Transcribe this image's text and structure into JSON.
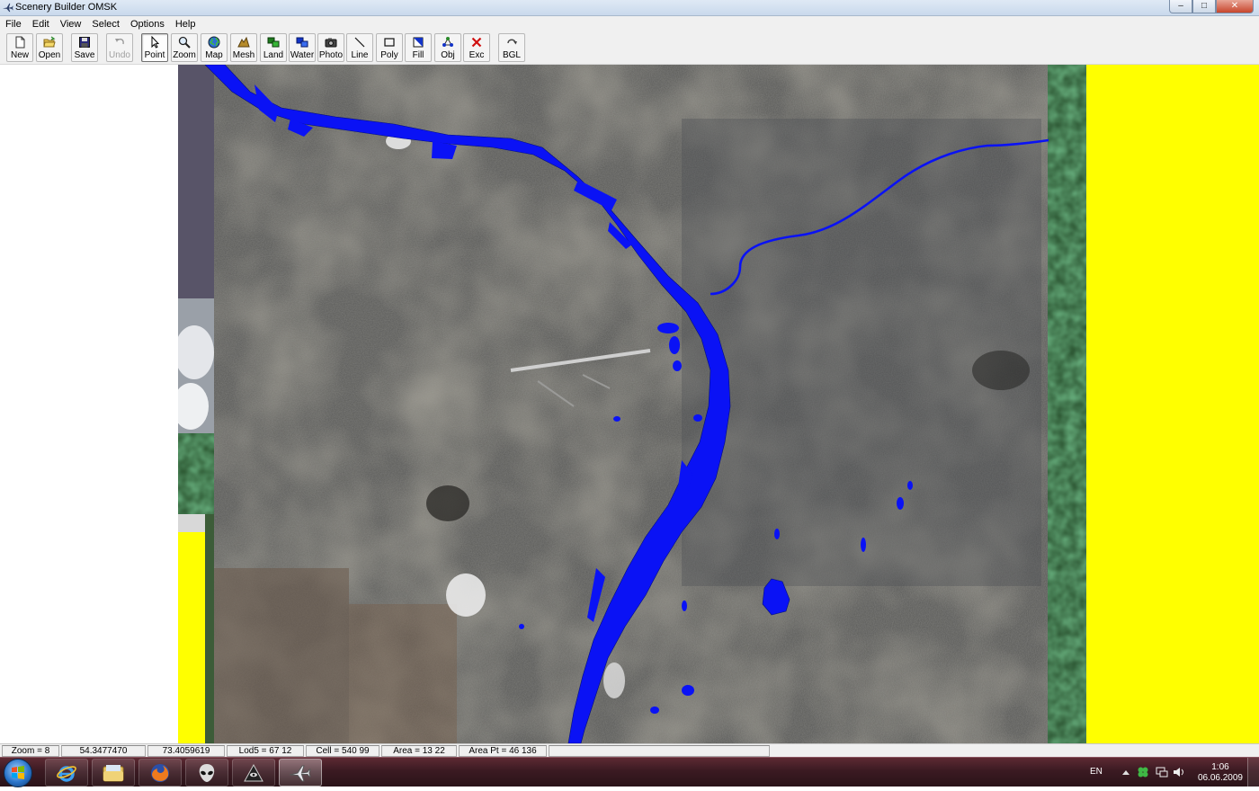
{
  "window": {
    "title": "Scenery Builder  OMSK",
    "controls": {
      "minimize": "–",
      "maximize": "□",
      "close": "✕"
    }
  },
  "menu": [
    "File",
    "Edit",
    "View",
    "Select",
    "Options",
    "Help"
  ],
  "toolbar": [
    {
      "label": "New",
      "icon": "new-file-icon"
    },
    {
      "label": "Open",
      "icon": "open-folder-icon"
    },
    {
      "label": "Save",
      "icon": "save-icon"
    },
    {
      "label": "Undo",
      "icon": "undo-icon",
      "disabled": true
    },
    {
      "label": "Point",
      "icon": "pointer-icon",
      "active": true
    },
    {
      "label": "Zoom",
      "icon": "magnifier-icon"
    },
    {
      "label": "Map",
      "icon": "globe-icon"
    },
    {
      "label": "Mesh",
      "icon": "mesh-icon"
    },
    {
      "label": "Land",
      "icon": "land-icon"
    },
    {
      "label": "Water",
      "icon": "water-icon"
    },
    {
      "label": "Photo",
      "icon": "camera-icon"
    },
    {
      "label": "Line",
      "icon": "line-icon"
    },
    {
      "label": "Poly",
      "icon": "polygon-icon"
    },
    {
      "label": "Fill",
      "icon": "fill-icon"
    },
    {
      "label": "Obj",
      "icon": "object-icon"
    },
    {
      "label": "Exc",
      "icon": "exclude-icon"
    },
    {
      "label": "BGL",
      "icon": "bgl-compile-icon"
    }
  ],
  "colors": {
    "water": "#0a12f5",
    "background_fill": "#ffff00",
    "satellite_base": "#5a5a58"
  },
  "status": [
    "Zoom = 8",
    "54.3477470",
    "73.4059619",
    "Lod5 = 67 12",
    "Cell = 540 99",
    "Area = 13 22",
    "Area Pt = 46 136"
  ],
  "taskbar": {
    "apps": [
      "internet-explorer-icon",
      "file-explorer-icon",
      "firefox-icon",
      "alien-app-icon",
      "eye-pyramid-app-icon",
      "airplane-app-icon"
    ],
    "language": "EN",
    "time": "1:06",
    "date": "06.06.2009"
  }
}
